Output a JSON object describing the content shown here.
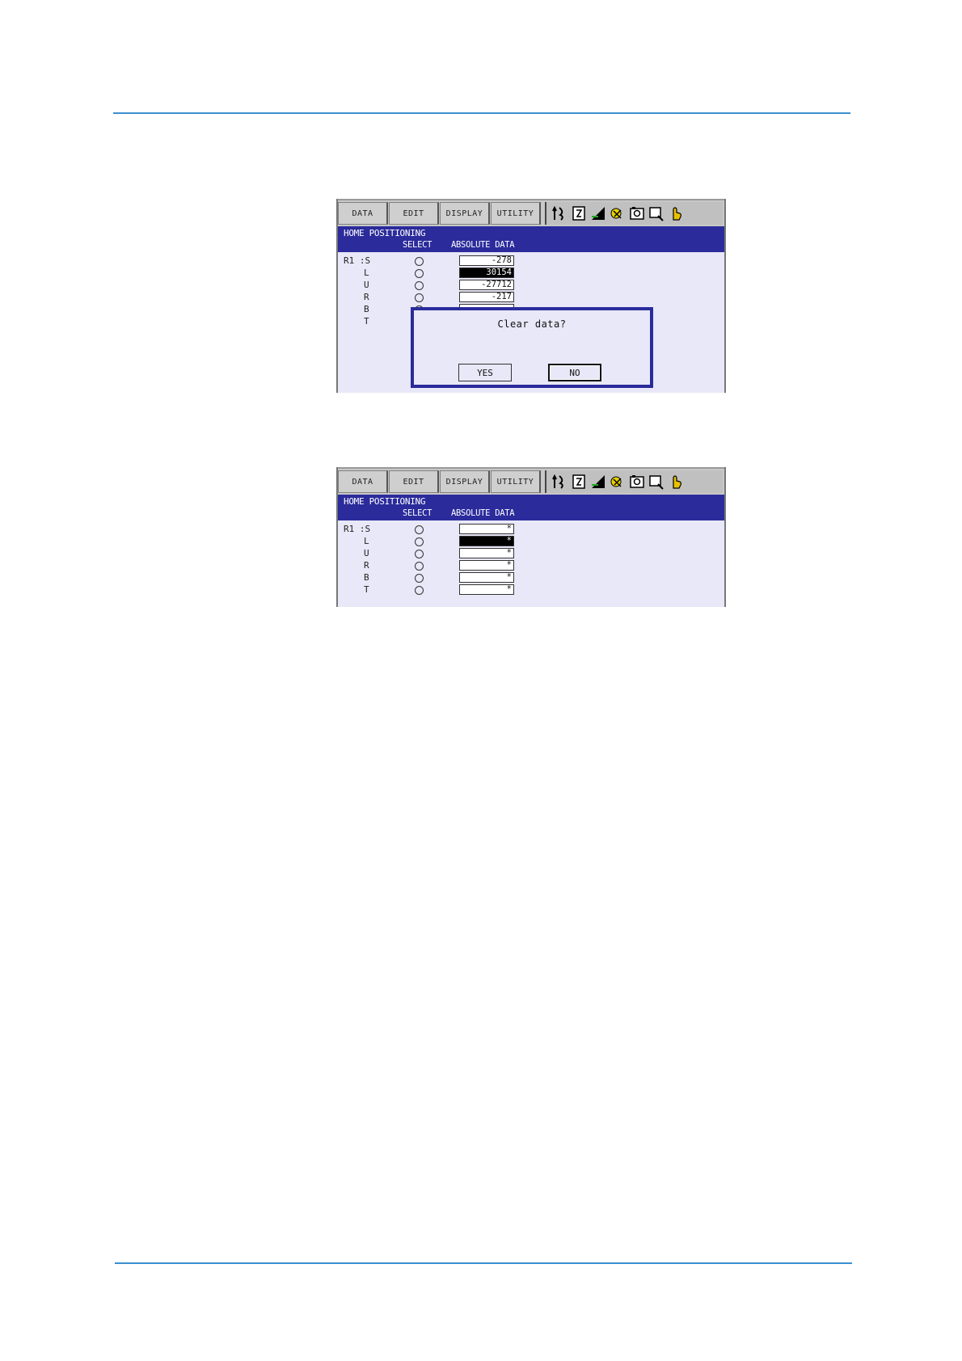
{
  "menu": [
    "DATA",
    "EDIT",
    "DISPLAY",
    "UTILITY"
  ],
  "screen_title": "HOME POSITIONING",
  "headers": {
    "select": "SELECT",
    "absolute_data": "ABSOLUTE DATA"
  },
  "axes": [
    "R1 :S",
    "L",
    "U",
    "R",
    "B",
    "T"
  ],
  "screen1": {
    "values": [
      "-278",
      "30154",
      "-27712",
      "-217",
      ""
    ],
    "selected_index": 1,
    "dialog": {
      "message": "Clear data?",
      "yes": "YES",
      "no": "NO"
    }
  },
  "screen2": {
    "values": [
      "*",
      "*",
      "*",
      "*",
      "*",
      "*"
    ],
    "selected_index": 1
  },
  "colors": {
    "title_bar": "#2b2b9c",
    "screen_bg": "#e8e8f8",
    "rule": "#3a8fcf"
  },
  "icons": [
    "cursor-icon",
    "page-icon",
    "signal-icon",
    "tool-icon",
    "camera-icon",
    "status-icon",
    "hand-icon"
  ]
}
